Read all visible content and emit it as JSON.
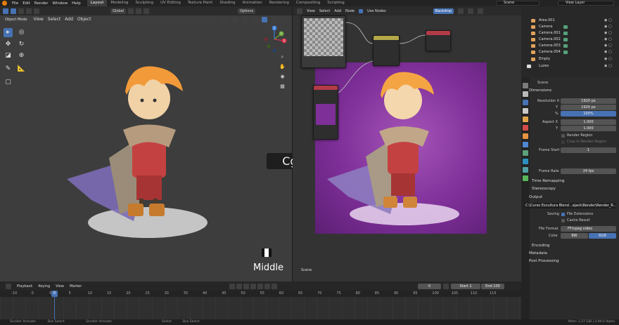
{
  "topbar": {
    "menus": [
      "File",
      "Edit",
      "Render",
      "Window",
      "Help"
    ],
    "workspaces": [
      "Layout",
      "Modeling",
      "Sculpting",
      "UV Editing",
      "Texture Paint",
      "Shading",
      "Animation",
      "Rendering",
      "Compositing",
      "Scripting"
    ],
    "active_workspace": "Layout",
    "scene": "Scene",
    "view_layer": "View Layer"
  },
  "viewport": {
    "header_items": [
      "Global"
    ],
    "options_label": "Options",
    "mode": "Object Mode",
    "menus": [
      "View",
      "Select",
      "Add",
      "Object"
    ],
    "gizmo_labels": [
      "Z",
      "Y",
      "X"
    ]
  },
  "node_editor": {
    "menus": [
      "View",
      "Select",
      "Add",
      "Node"
    ],
    "use_nodes_label": "Use Nodes",
    "backdrop_label": "Backdrop",
    "scene_label": "Scene"
  },
  "watermark": {
    "text": "Cger.com",
    "mouse_label": "Middle"
  },
  "outliner": {
    "rows": [
      {
        "name": "Area.001",
        "cam": false
      },
      {
        "name": "Camera",
        "cam": true
      },
      {
        "name": "Camera.001",
        "cam": true
      },
      {
        "name": "Camera.002",
        "cam": true
      },
      {
        "name": "Camera.003",
        "cam": true
      },
      {
        "name": "Camera.004",
        "cam": true
      },
      {
        "name": "Empty",
        "cam": false
      },
      {
        "name": "Luzes",
        "cam": false
      }
    ]
  },
  "properties": {
    "scene_name": "Scene",
    "sections": {
      "dimensions": "Dimensions",
      "time_remapping": "Time Remapping",
      "stereoscopy": "Stereoscopy",
      "output": "Output",
      "encoding": "Encoding",
      "metadata": "Metadata",
      "post_processing": "Post Processing"
    },
    "resolution_x_label": "Resolution X",
    "resolution_x": "1920 px",
    "y_label": "Y",
    "resolution_y": "1920 px",
    "percent_label": "%",
    "percent": "100%",
    "aspect_x_label": "Aspect X",
    "aspect_x": "1.000",
    "aspect_y": "1.000",
    "render_region": "Render Region",
    "crop_region": "Crop to Render Region",
    "frame_start_label": "Frame Start",
    "frame_start": "1",
    "frame_rate_label": "Frame Rate",
    "frame_rate": "24 fps",
    "output_path": "C:\\Curso Escultura Blend...ejack\\Render\\Render_R...",
    "saving_label": "Saving",
    "file_extensions": "File Extensions",
    "cache_result": "Cache Result",
    "file_format_label": "File Format",
    "file_format": "FFmpeg video",
    "color_label": "Color",
    "color_bw": "BW",
    "color_rgb": "RGB"
  },
  "timeline": {
    "menus": [
      "Playback",
      "Keying",
      "View",
      "Marker"
    ],
    "current_frame": "0",
    "start_label": "Start",
    "start": "1",
    "end_label": "End",
    "end": "100",
    "ticks": [
      "-10",
      "-5",
      "0",
      "5",
      "10",
      "15",
      "20",
      "25",
      "30",
      "35",
      "40",
      "45",
      "50",
      "55",
      "60",
      "65",
      "70",
      "75",
      "80",
      "85",
      "90",
      "95",
      "100",
      "105",
      "110",
      "115"
    ],
    "playhead": "0"
  },
  "status": {
    "items": [
      "Scroller Activate",
      "Box Select",
      "Scroller Activate",
      "Select",
      "Box Select"
    ],
    "memory": "Mem: 1.27 GiB | 2.90.0 Alpha"
  }
}
